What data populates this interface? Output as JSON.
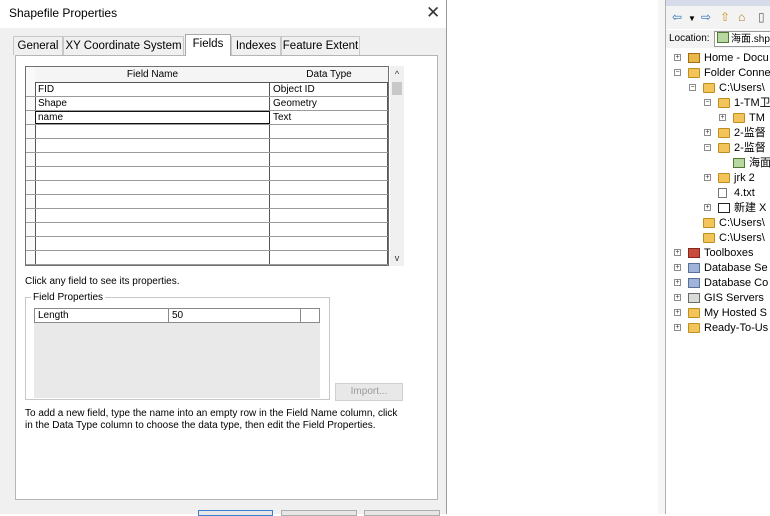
{
  "dialog": {
    "title": "Shapefile Properties",
    "close_glyph": "✕",
    "tabs": [
      {
        "label": "General"
      },
      {
        "label": "XY Coordinate System"
      },
      {
        "label": "Fields"
      },
      {
        "label": "Indexes"
      },
      {
        "label": "Feature Extent"
      }
    ],
    "active_tab": "Fields",
    "grid": {
      "headers": [
        "Field Name",
        "Data Type"
      ],
      "rows": [
        {
          "name": "FID",
          "type": "Object ID"
        },
        {
          "name": "Shape",
          "type": "Geometry"
        },
        {
          "name": "name",
          "type": "Text"
        },
        {
          "name": "",
          "type": ""
        },
        {
          "name": "",
          "type": ""
        },
        {
          "name": "",
          "type": ""
        },
        {
          "name": "",
          "type": ""
        },
        {
          "name": "",
          "type": ""
        },
        {
          "name": "",
          "type": ""
        },
        {
          "name": "",
          "type": ""
        },
        {
          "name": "",
          "type": ""
        },
        {
          "name": "",
          "type": ""
        },
        {
          "name": "",
          "type": ""
        }
      ],
      "scroll_up_glyph": "^",
      "scroll_down_glyph": "v"
    },
    "hint": "Click any field to see its properties.",
    "field_properties": {
      "label": "Field Properties",
      "rows": [
        {
          "property": "Length",
          "value": "50"
        }
      ]
    },
    "import_button": "Import...",
    "instructions": "To add a new field, type the name into an empty row in the Field Name column, click in the Data Type column to choose the data type, then edit the Field Properties."
  },
  "catalog": {
    "toolbar_icons": [
      "back-arrow-icon",
      "dropdown-arrow-icon",
      "forward-arrow-icon",
      "up-folder-icon",
      "home-icon",
      "document-icon"
    ],
    "location_label": "Location:",
    "location_value": "海面.shp",
    "tree": [
      {
        "label": "Home - Docu",
        "icon": "home",
        "pm": "+",
        "level": 0
      },
      {
        "label": "Folder Conne",
        "icon": "folder",
        "pm": "−",
        "level": 0
      },
      {
        "label": "C:\\Users\\",
        "icon": "folder",
        "pm": "−",
        "level": 1
      },
      {
        "label": "1-TM卫",
        "icon": "folder",
        "pm": "−",
        "level": 2
      },
      {
        "label": "TM",
        "icon": "folder",
        "pm": "+",
        "level": 3
      },
      {
        "label": "2-监督",
        "icon": "folder",
        "pm": "+",
        "level": 2
      },
      {
        "label": "2-监督",
        "icon": "folder",
        "pm": "−",
        "level": 2
      },
      {
        "label": "海面",
        "icon": "shp",
        "pm": "",
        "level": 3
      },
      {
        "label": "jrk 2",
        "icon": "folder",
        "pm": "+",
        "level": 2
      },
      {
        "label": "4.txt",
        "icon": "file",
        "pm": "",
        "level": 2
      },
      {
        "label": "新建 X",
        "icon": "xy",
        "pm": "+",
        "level": 2
      },
      {
        "label": "C:\\Users\\",
        "icon": "folder",
        "pm": "",
        "level": 1
      },
      {
        "label": "C:\\Users\\",
        "icon": "folder",
        "pm": "",
        "level": 1
      },
      {
        "label": "Toolboxes",
        "icon": "tool",
        "pm": "+",
        "level": 0
      },
      {
        "label": "Database Se",
        "icon": "db",
        "pm": "+",
        "level": 0
      },
      {
        "label": "Database Co",
        "icon": "db",
        "pm": "+",
        "level": 0
      },
      {
        "label": "GIS Servers",
        "icon": "gis",
        "pm": "+",
        "level": 0
      },
      {
        "label": "My Hosted S",
        "icon": "folder",
        "pm": "+",
        "level": 0
      },
      {
        "label": "Ready-To-Us",
        "icon": "folder",
        "pm": "+",
        "level": 0
      }
    ]
  }
}
